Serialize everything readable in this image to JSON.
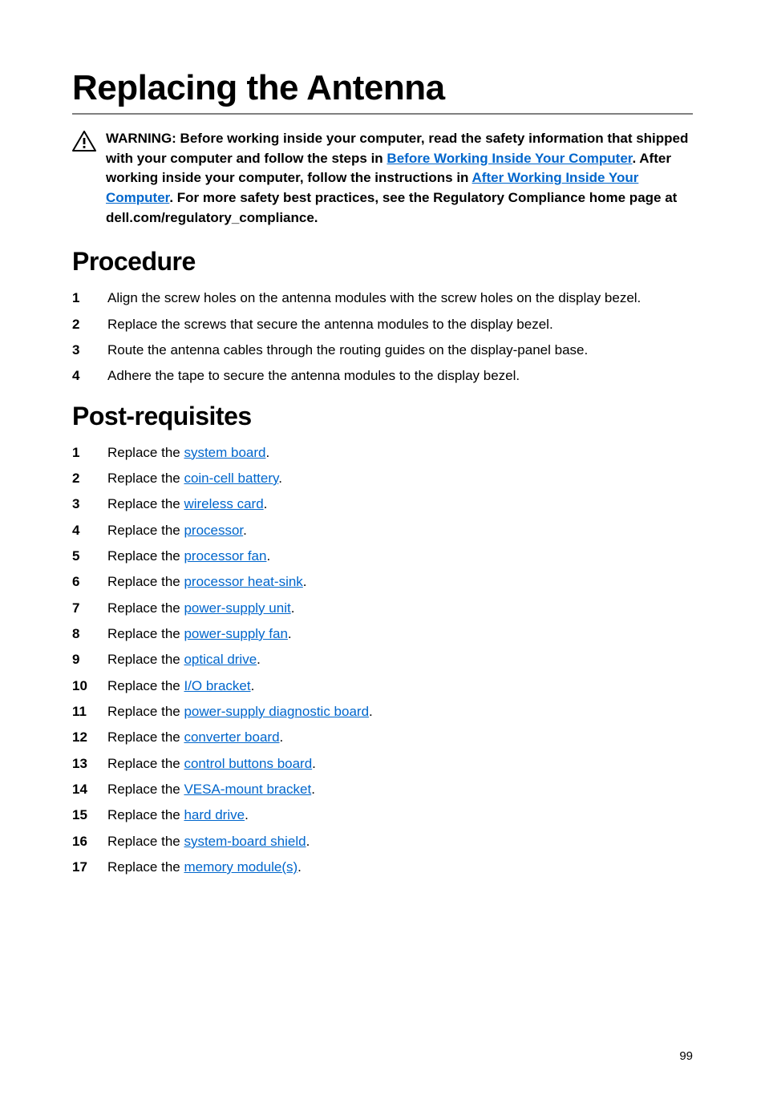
{
  "title": "Replacing the Antenna",
  "warning": {
    "t1": "WARNING: Before working inside your computer, read the safety information that shipped with your computer and follow the steps in ",
    "l1": "Before Working Inside Your Computer",
    "t2": ". After working inside your computer, follow the instructions in ",
    "l2": "After Working Inside Your Computer",
    "t3": ". For more safety best practices, see the Regulatory Compliance home page at dell.com/regulatory_compliance."
  },
  "procedure_heading": "Procedure",
  "procedure": [
    "Align the screw holes on the antenna modules with the screw holes on the display bezel.",
    "Replace the screws that secure the antenna modules to the display bezel.",
    "Route the antenna cables through the routing guides on the display-panel base.",
    "Adhere the tape to secure the antenna modules to the display bezel."
  ],
  "postreq_heading": "Post-requisites",
  "replace_prefix": "Replace the ",
  "postreq": [
    "system board",
    "coin-cell battery",
    "wireless card",
    "processor",
    "processor fan",
    "processor heat-sink",
    "power-supply unit",
    "power-supply fan",
    "optical drive",
    "I/O bracket",
    "power-supply diagnostic board",
    "converter board",
    "control buttons board",
    "VESA-mount bracket",
    "hard drive",
    "system-board shield",
    "memory module(s)"
  ],
  "page_number": "99"
}
